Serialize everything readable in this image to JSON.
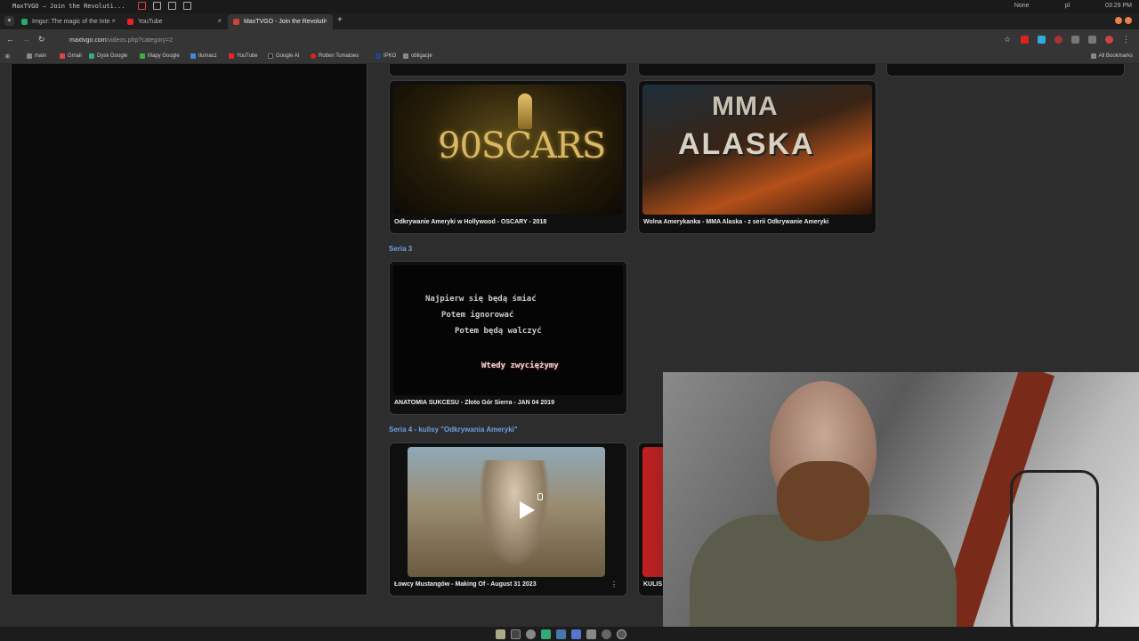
{
  "os": {
    "window_title": "MaxTVGO – Join the Revoluti...",
    "right": [
      "None",
      "pl",
      "03:29 PM"
    ]
  },
  "tabs": [
    {
      "label": "Imgur: The magic of the Inte",
      "color": "#2aa86a"
    },
    {
      "label": "YouTube",
      "color": "#e22"
    },
    {
      "label": "MaxTVGO - Join the Revoluti",
      "color": "#c43"
    }
  ],
  "address": {
    "host": "maxtvgo.com",
    "path": "/videos.php?category=2"
  },
  "bookmarks": [
    {
      "label": "main",
      "color": "#888"
    },
    {
      "label": "Gmail",
      "color": "#d44"
    },
    {
      "label": "Dysk Google",
      "color": "#3a8"
    },
    {
      "label": "Mapy Google",
      "color": "#4a4"
    },
    {
      "label": "tłumacz",
      "color": "#48d"
    },
    {
      "label": "YouTube",
      "color": "#e22"
    },
    {
      "label": "Google AI",
      "color": "#222"
    },
    {
      "label": "Rotten Tomatoes",
      "color": "#d22"
    },
    {
      "label": "IPKO",
      "color": "#248"
    },
    {
      "label": "obligacje",
      "color": "#888"
    }
  ],
  "all_bookmarks": "All Bookmarks",
  "videos": {
    "oscars": {
      "caption": "Odkrywanie Ameryki w Hollywood - OSCARY - 2018",
      "thumb_text": "90SCARS"
    },
    "mma": {
      "caption": "Wolna Amerykanka - MMA Alaska - z serii Odkrywanie Ameryki",
      "thumb_line1": "MMA",
      "thumb_line2": "ALASKA"
    },
    "anatomia": {
      "caption": "ANATOMIA SUKCESU - Złoto Gór Sierra - JAN 04 2019",
      "lines": [
        "Najpierw się będą śmiać",
        "Potem ignorować",
        "Potem będą walczyć",
        "Wtedy zwyciężymy"
      ]
    },
    "lowcy": {
      "caption": "Łowcy Mustangów - Making Of - August 31 2023"
    },
    "kulisy": {
      "caption": "KULIS"
    }
  },
  "sections": {
    "seria3": "Seria 3",
    "seria4": "Seria 4 - kulisy \"Odkrywania Ameryki\""
  }
}
